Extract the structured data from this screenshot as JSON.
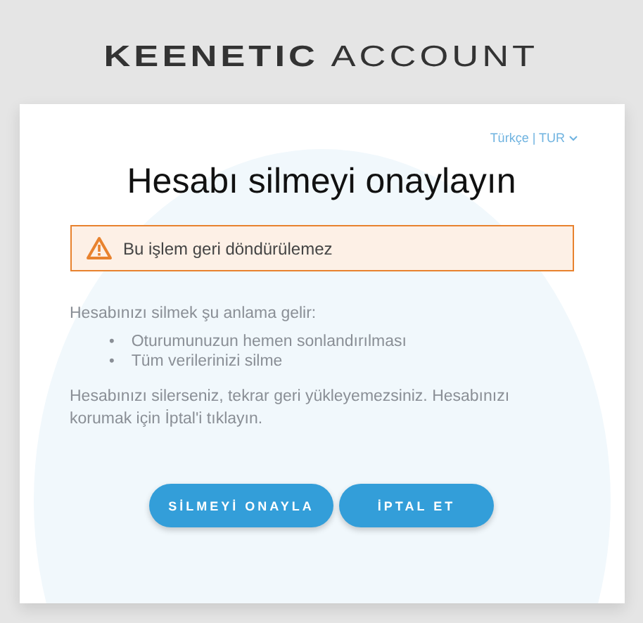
{
  "logo": {
    "brand": "KEENETIC",
    "product": "ACCOUNT"
  },
  "language": {
    "label": "Türkçe | TUR"
  },
  "title": "Hesabı silmeyi onaylayın",
  "warning": {
    "text": "Bu işlem geri döndürülemez"
  },
  "intro": "Hesabınızı silmek şu anlama gelir:",
  "consequences": [
    {
      "marker": "•",
      "text": "Oturumunuzun hemen sonlandırılması"
    },
    {
      "marker": "•",
      "text": "Tüm verilerinizi silme"
    }
  ],
  "note": "Hesabınızı silerseniz, tekrar geri yükleyemezsiniz. Hesabınızı korumak için İptal'i tıklayın.",
  "buttons": [
    {
      "label": "SİLMEYİ ONAYLA",
      "kind": "confirm"
    },
    {
      "label": "İPTAL ET",
      "kind": "cancel"
    }
  ]
}
